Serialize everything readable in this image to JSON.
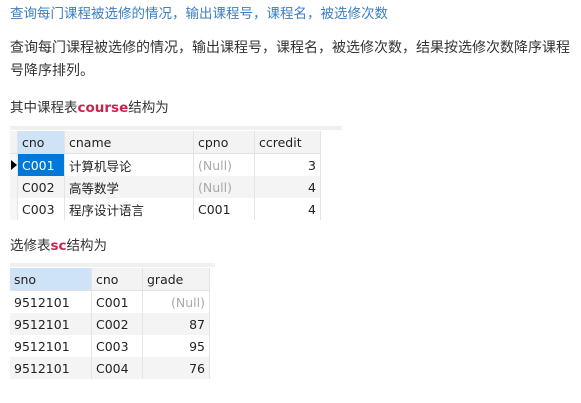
{
  "title": "查询每门课程被选修的情况，输出课程号，课程名，被选修次数",
  "description": "查询每门课程被选修的情况，输出课程号，课程名，被选修次数，结果按选修次数降序课程号降序排列。",
  "course_section": {
    "prefix": "其中课程表",
    "keyword": "course",
    "suffix": "结构为"
  },
  "sc_section": {
    "prefix": "选修表",
    "keyword": "sc",
    "suffix": "结构为"
  },
  "course_table": {
    "columns": [
      "cno",
      "cname",
      "cpno",
      "ccredit"
    ],
    "rows": [
      [
        "C001",
        "计算机导论",
        "(Null)",
        "3"
      ],
      [
        "C002",
        "高等数学",
        "(Null)",
        "4"
      ],
      [
        "C003",
        "程序设计语言",
        "C001",
        "4"
      ]
    ]
  },
  "sc_table": {
    "columns": [
      "sno",
      "cno",
      "grade"
    ],
    "rows": [
      [
        "9512101",
        "C001",
        "(Null)"
      ],
      [
        "9512101",
        "C002",
        "87"
      ],
      [
        "9512101",
        "C003",
        "95"
      ],
      [
        "9512101",
        "C004",
        "76"
      ]
    ]
  },
  "colors": {
    "title": "#3d7fc1",
    "keyword": "#c7254e",
    "selected_cell": "#0078d7",
    "selected_header": "#cfe3f7"
  },
  "icons": {
    "row_pointer": "row-pointer-icon"
  }
}
